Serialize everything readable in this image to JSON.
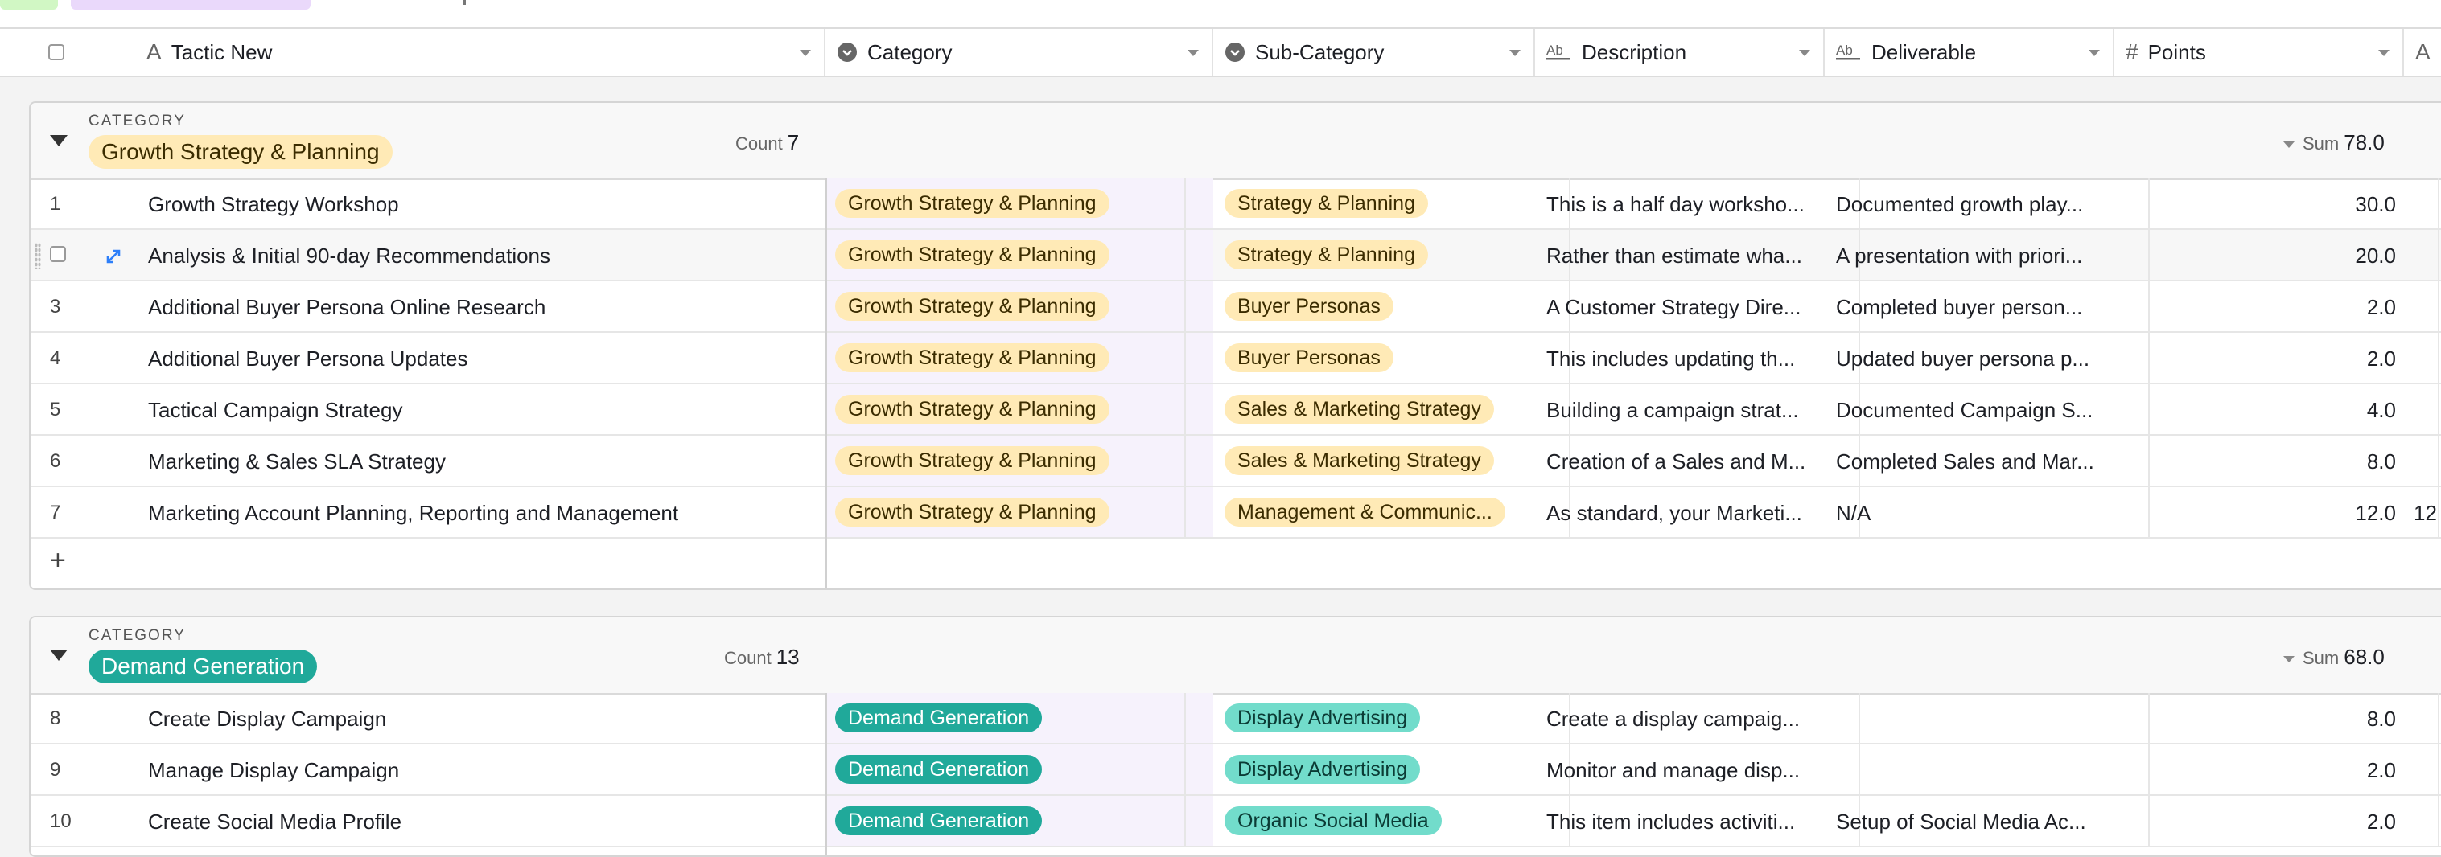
{
  "columns": {
    "tactic": "Tactic New",
    "category": "Category",
    "subcategory": "Sub-Category",
    "description": "Description",
    "deliverable": "Deliverable",
    "points": "Points",
    "extra_icon": "A"
  },
  "colors": {
    "growth_chip_bg": "#ffeab6",
    "growth_chip_text": "#3b2c00",
    "demand_chip_bg": "#20a99a",
    "demand_sub_bg": "#72dccb",
    "demand_chip_text": "#ffffff",
    "expand_icon": "#2d7ff9"
  },
  "groups": [
    {
      "label": "CATEGORY",
      "name": "Growth Strategy & Planning",
      "count_label": "Count",
      "count": "7",
      "sum_label": "Sum",
      "sum": "78.0",
      "rows": [
        {
          "num": "1",
          "title": "Growth Strategy Workshop",
          "category": "Growth Strategy & Planning",
          "sub": "Strategy & Planning",
          "description": "This is a half day worksho...",
          "deliverable": "Documented growth play...",
          "points": "30.0"
        },
        {
          "num": "",
          "title": "Analysis & Initial 90-day Recommendations",
          "category": "Growth Strategy & Planning",
          "sub": "Strategy & Planning",
          "description": "Rather than estimate wha...",
          "deliverable": "A presentation with priori...",
          "points": "20.0"
        },
        {
          "num": "3",
          "title": "Additional Buyer Persona Online Research",
          "category": "Growth Strategy & Planning",
          "sub": "Buyer Personas",
          "description": "A Customer Strategy Dire...",
          "deliverable": "Completed buyer person...",
          "points": "2.0"
        },
        {
          "num": "4",
          "title": "Additional Buyer Persona Updates",
          "category": "Growth Strategy & Planning",
          "sub": "Buyer Personas",
          "description": "This includes updating th...",
          "deliverable": "Updated buyer persona p...",
          "points": "2.0"
        },
        {
          "num": "5",
          "title": "Tactical Campaign Strategy",
          "category": "Growth Strategy & Planning",
          "sub": "Sales & Marketing Strategy",
          "description": "Building a campaign strat...",
          "deliverable": "Documented Campaign S...",
          "points": "4.0"
        },
        {
          "num": "6",
          "title": "Marketing & Sales SLA Strategy",
          "category": "Growth Strategy & Planning",
          "sub": "Sales & Marketing Strategy",
          "description": "Creation of a Sales and M...",
          "deliverable": "Completed Sales and Mar...",
          "points": "8.0"
        },
        {
          "num": "7",
          "title": "Marketing Account Planning, Reporting and Management",
          "category": "Growth Strategy & Planning",
          "sub": "Management & Communic...",
          "description": "As standard, your Marketi...",
          "deliverable": "N/A",
          "points": "12.0",
          "extra": "12"
        }
      ],
      "add_label": "+"
    },
    {
      "label": "CATEGORY",
      "name": "Demand Generation",
      "count_label": "Count",
      "count": "13",
      "sum_label": "Sum",
      "sum": "68.0",
      "rows": [
        {
          "num": "8",
          "title": "Create Display Campaign",
          "category": "Demand Generation",
          "sub": "Display Advertising",
          "description": "Create a display campaig...",
          "deliverable": "",
          "points": "8.0"
        },
        {
          "num": "9",
          "title": "Manage Display Campaign",
          "category": "Demand Generation",
          "sub": "Display Advertising",
          "description": "Monitor and manage disp...",
          "deliverable": "",
          "points": "2.0"
        },
        {
          "num": "10",
          "title": "Create Social Media Profile",
          "category": "Demand Generation",
          "sub": "Organic Social Media",
          "description": "This item includes activiti...",
          "deliverable": "Setup of Social Media Ac...",
          "points": "2.0"
        }
      ]
    }
  ]
}
